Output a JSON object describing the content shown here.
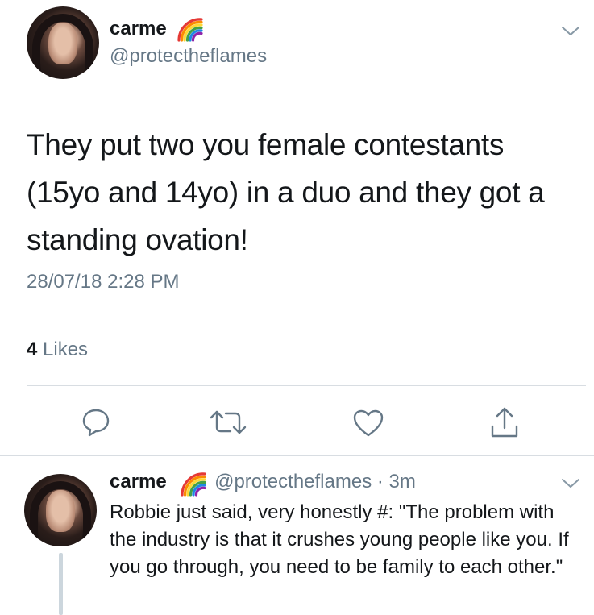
{
  "main_tweet": {
    "name": "carme",
    "handle": "@protectheflames",
    "text": "They put two you female contestants (15yo and 14yo) in a duo and they got a standing ovation!",
    "timestamp": "28/07/18 2:28 PM",
    "likes_count": "4",
    "likes_label": "Likes"
  },
  "reply_tweet": {
    "name": "carme",
    "handle": "@protectheflames",
    "separator": "·",
    "time": "3m",
    "text": "Robbie just said, very honestly #: \"The problem with the industry is that it crushes young people like you. If you go through, you need to be family to each other.\""
  },
  "colors": {
    "text": "#14171a",
    "secondary": "#657786",
    "icon": "#657786",
    "divider": "#d8dde2"
  },
  "icons": [
    "chevron-down-icon",
    "rainbow-emoji-icon",
    "reply-icon",
    "retweet-icon",
    "like-icon",
    "share-icon"
  ]
}
